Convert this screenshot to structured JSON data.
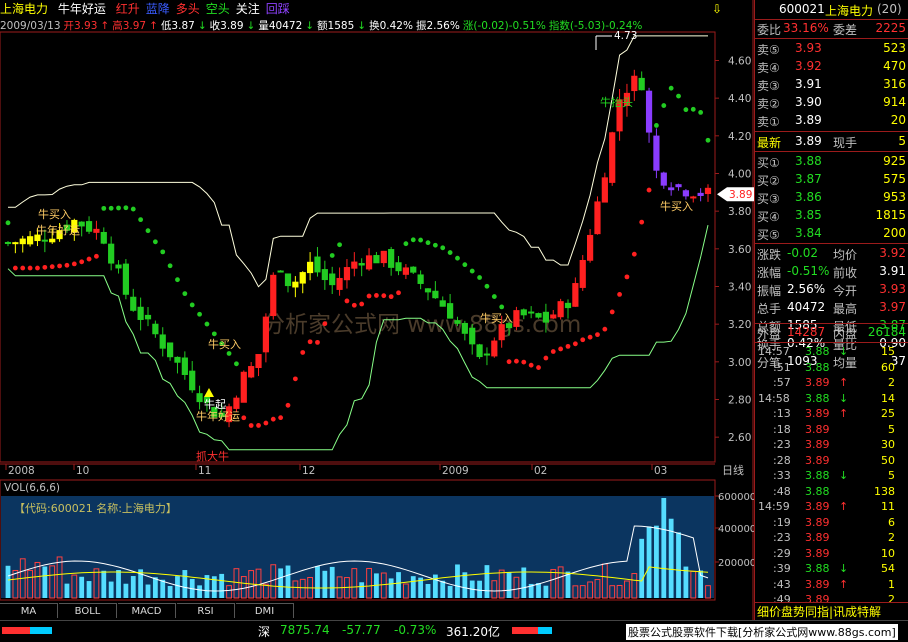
{
  "header": {
    "stock_name": "上海电力",
    "indicator": "牛年好运",
    "signals": [
      {
        "label": "红升",
        "color": "#ff3030"
      },
      {
        "label": "蓝降",
        "color": "#3a5cff"
      },
      {
        "label": "多头",
        "color": "#ff3030"
      },
      {
        "label": "空头",
        "color": "#22dd22"
      },
      {
        "label": "关注",
        "color": "#ffffff"
      },
      {
        "label": "回踩",
        "color": "#8f42ff"
      }
    ]
  },
  "info": [
    {
      "text": "2009/03/13",
      "color": "#c0c0c0"
    },
    {
      "text": "开3.93",
      "color": "#ff3030"
    },
    {
      "text": "↑",
      "color": "#ff3030"
    },
    {
      "text": "高3.97",
      "color": "#ff3030"
    },
    {
      "text": "↑",
      "color": "#ff3030"
    },
    {
      "text": "低3.87",
      "color": "#ffffff"
    },
    {
      "text": "↓",
      "color": "#22dd22"
    },
    {
      "text": "收3.89",
      "color": "#ffffff"
    },
    {
      "text": "↓",
      "color": "#22dd22"
    },
    {
      "text": "量40472",
      "color": "#ffffff"
    },
    {
      "text": "↓",
      "color": "#22dd22"
    },
    {
      "text": "额1585",
      "color": "#ffffff"
    },
    {
      "text": "↓",
      "color": "#22dd22"
    },
    {
      "text": "换0.42%",
      "color": "#ffffff"
    },
    {
      "text": "振2.56%",
      "color": "#ffffff"
    },
    {
      "text": "涨(-0.02)-0.51%",
      "color": "#22dd22"
    },
    {
      "text": "指数(-5.03)-0.24%",
      "color": "#22dd22"
    }
  ],
  "price_axis": [
    "4.60",
    "4.40",
    "4.20",
    "4.00",
    "3.80",
    "3.60",
    "3.40",
    "3.20",
    "3.00",
    "2.80",
    "2.60"
  ],
  "price_tag": "3.89",
  "high_label": "4.73",
  "date_axis": {
    "labels": [
      "2008",
      "10",
      "11",
      "12",
      "2009",
      "02",
      "03"
    ],
    "period": "日线"
  },
  "annotations": {
    "buy": "牛买入",
    "lucky": "牛年好运",
    "bull_rise": "牛起",
    "bull_head": "牛抬头",
    "catch_bull": "抓大牛",
    "watermark": "分析家公式网 www.88gs.com"
  },
  "volume": {
    "title": "VOL(6,6,6)",
    "code_line": "【代码:600021 名称:上海电力】",
    "axis": [
      "600000",
      "400000",
      "200000"
    ],
    "colors": {
      "up": "#ff4040",
      "down": "#55ddff",
      "ma1": "#ffffff",
      "ma2": "#ffff00"
    }
  },
  "tabs": [
    "MA",
    "BOLL",
    "MACD",
    "RSI",
    "DMI"
  ],
  "status": {
    "market": "深",
    "index_value": "7875.74",
    "change": "-57.77",
    "percent": "-0.73%",
    "amount": "361.20亿",
    "ticker_text": "股票公式股票软件下载[分析家公式网www.88gs.com]"
  },
  "panel": {
    "code": "600021",
    "name": "上海电力",
    "num": "(20)",
    "weibi_label": "委比",
    "weibi_value": "33.16%",
    "weicha_label": "委差",
    "weicha_value": "2225",
    "sell": [
      {
        "label": "卖⑤",
        "price": "3.93",
        "vol": "523"
      },
      {
        "label": "卖④",
        "price": "3.92",
        "vol": "470"
      },
      {
        "label": "卖③",
        "price": "3.91",
        "vol": "316"
      },
      {
        "label": "卖②",
        "price": "3.90",
        "vol": "914"
      },
      {
        "label": "卖①",
        "price": "3.89",
        "vol": "20"
      }
    ],
    "latest_label": "最新",
    "latest_value": "3.89",
    "now_label": "现手",
    "now_value": "5",
    "buy": [
      {
        "label": "买①",
        "price": "3.88",
        "vol": "925"
      },
      {
        "label": "买②",
        "price": "3.87",
        "vol": "575"
      },
      {
        "label": "买③",
        "price": "3.86",
        "vol": "953"
      },
      {
        "label": "买④",
        "price": "3.85",
        "vol": "1815"
      },
      {
        "label": "买⑤",
        "price": "3.84",
        "vol": "200"
      }
    ],
    "stats": [
      {
        "l1": "涨跌",
        "v1": "-0.02",
        "c1": "#22dd22",
        "l2": "均价",
        "v2": "3.92",
        "c2": "#ff3030"
      },
      {
        "l1": "涨幅",
        "v1": "-0.51%",
        "c1": "#22dd22",
        "l2": "前收",
        "v2": "3.91",
        "c2": "#ffffff"
      },
      {
        "l1": "振幅",
        "v1": "2.56%",
        "c1": "#ffffff",
        "l2": "今开",
        "v2": "3.93",
        "c2": "#ff3030"
      },
      {
        "l1": "总手",
        "v1": "40472",
        "c1": "#ffffff",
        "l2": "最高",
        "v2": "3.97",
        "c2": "#ff3030"
      },
      {
        "l1": "总额",
        "v1": "1585",
        "c1": "#ffffff",
        "l2": "最低",
        "v2": "3.87",
        "c2": "#22dd22"
      },
      {
        "l1": "换手",
        "v1": "0.42%",
        "c1": "#ffffff",
        "l2": "量比",
        "v2": "0.90",
        "c2": "#ffffff"
      },
      {
        "l1": "分笔",
        "v1": "1093",
        "c1": "#ffffff",
        "l2": "均量",
        "v2": "37",
        "c2": "#ffffff"
      }
    ],
    "outer_label": "外盘",
    "outer_value": "14287",
    "inner_label": "内盘",
    "inner_value": "26184",
    "ticks": [
      {
        "t": "14:57",
        "p": "3.88",
        "d": "↓",
        "v": "15"
      },
      {
        "t": ":51",
        "p": "3.88",
        "d": "",
        "v": "60"
      },
      {
        "t": ":57",
        "p": "3.89",
        "d": "↑",
        "v": "2"
      },
      {
        "t": "14:58",
        "p": "3.88",
        "d": "↓",
        "v": "14"
      },
      {
        "t": ":13",
        "p": "3.89",
        "d": "↑",
        "v": "25"
      },
      {
        "t": ":18",
        "p": "3.89",
        "d": "",
        "v": "5"
      },
      {
        "t": ":23",
        "p": "3.89",
        "d": "",
        "v": "30"
      },
      {
        "t": ":28",
        "p": "3.89",
        "d": "",
        "v": "50"
      },
      {
        "t": ":33",
        "p": "3.88",
        "d": "↓",
        "v": "5"
      },
      {
        "t": ":48",
        "p": "3.88",
        "d": "",
        "v": "138"
      },
      {
        "t": "14:59",
        "p": "3.89",
        "d": "↑",
        "v": "11"
      },
      {
        "t": ":19",
        "p": "3.89",
        "d": "",
        "v": "6"
      },
      {
        "t": ":23",
        "p": "3.89",
        "d": "",
        "v": "2"
      },
      {
        "t": ":29",
        "p": "3.89",
        "d": "",
        "v": "10"
      },
      {
        "t": ":39",
        "p": "3.88",
        "d": "↓",
        "v": "54"
      },
      {
        "t": ":43",
        "p": "3.89",
        "d": "↑",
        "v": "1"
      },
      {
        "t": ":49",
        "p": "3.89",
        "d": "",
        "v": "2"
      }
    ],
    "bottom_tabs": "细价盘势同指|讯成特解"
  }
}
